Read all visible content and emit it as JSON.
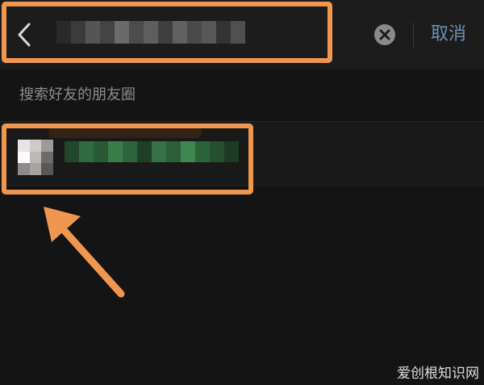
{
  "search": {
    "query_obscured": true,
    "cancel_label": "取消"
  },
  "hint": {
    "label": "搜索好友的朋友圈"
  },
  "result": {
    "name_obscured": true
  },
  "watermark": "爱创根知识网",
  "colors": {
    "background": "#141414",
    "header": "#1c1c1c",
    "cancel_text": "#6f8fb8",
    "hint_text": "#8c8c8c",
    "highlight": "#f0974f",
    "name_mosaic": "#2f6b3f"
  },
  "icons": {
    "back": "chevron-left-icon",
    "clear": "clear-circle-icon",
    "annotation": "arrow-up-left-icon"
  }
}
